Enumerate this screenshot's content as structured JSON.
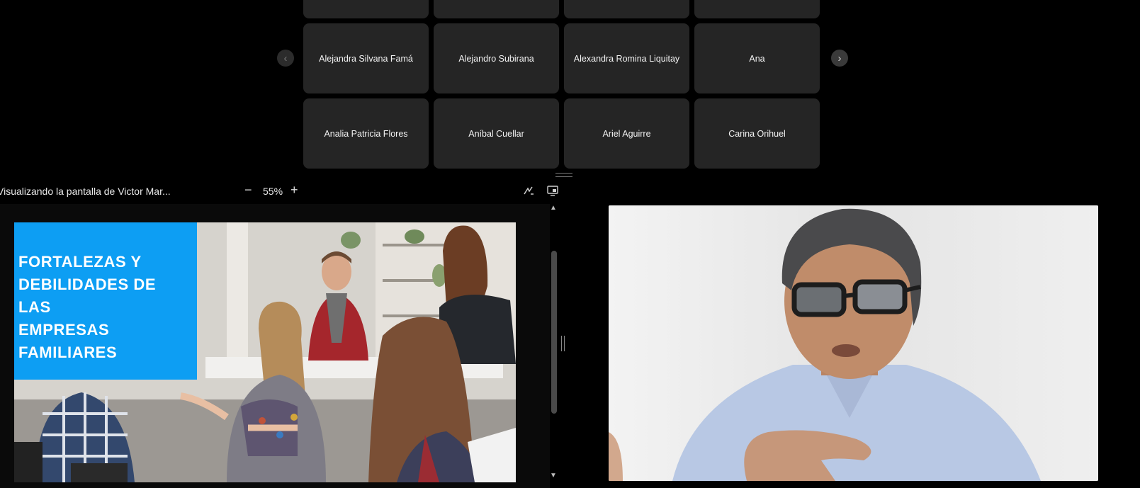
{
  "gallery": {
    "participants": [
      "Alejandra Silvana Famá",
      "Alejandro Subirana",
      "Alexandra Romina Liquitay",
      "Ana",
      "Analia Patricia Flores",
      "Aníbal Cuellar",
      "Ariel Aguirre",
      "Carina Orihuel"
    ],
    "prev_icon": "‹",
    "next_icon": "›"
  },
  "share": {
    "title": "Visualizando la pantalla de Victor Mar...",
    "zoom": "55%",
    "zoom_out_label": "−",
    "zoom_in_label": "+",
    "slide_title": [
      "FORTALEZAS Y",
      "DEBILIDADES DE",
      "LAS",
      "EMPRESAS",
      "FAMILIARES"
    ]
  },
  "colors": {
    "background": "#000000",
    "tile": "#252525",
    "slide_accent": "#0d9ef3"
  }
}
